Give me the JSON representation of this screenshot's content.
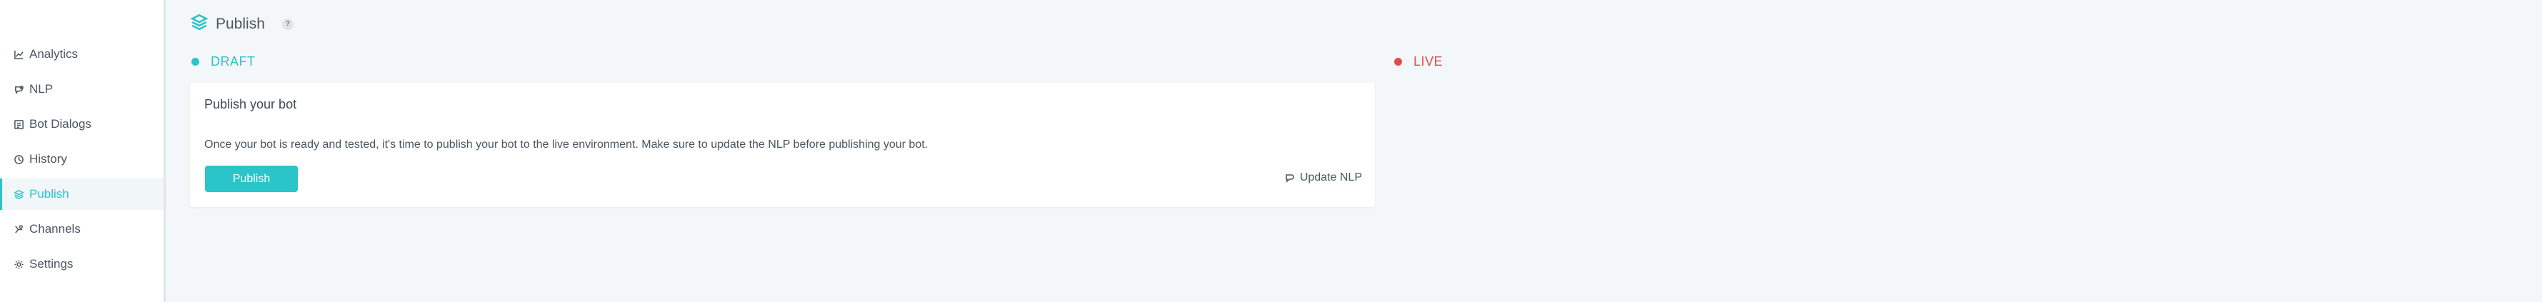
{
  "sidebar": {
    "items": [
      {
        "label": "Analytics",
        "icon": "chart-icon"
      },
      {
        "label": "NLP",
        "icon": "nlp-icon"
      },
      {
        "label": "Bot Dialogs",
        "icon": "dialogs-icon"
      },
      {
        "label": "History",
        "icon": "clock-icon"
      },
      {
        "label": "Publish",
        "icon": "layers-icon",
        "active": true
      },
      {
        "label": "Channels",
        "icon": "channels-icon"
      },
      {
        "label": "Settings",
        "icon": "gear-icon"
      }
    ]
  },
  "header": {
    "title": "Publish",
    "help": "?"
  },
  "status": {
    "draft": "DRAFT",
    "live": "LIVE"
  },
  "card": {
    "title": "Publish your bot",
    "description": "Once your bot is ready and tested, it's time to publish your bot to the live environment. Make sure to update the NLP before publishing your bot.",
    "publish_label": "Publish",
    "update_nlp_label": "Update NLP"
  },
  "colors": {
    "accent": "#2bc4c8",
    "live": "#e04b4b",
    "background": "#f4f7f9"
  }
}
